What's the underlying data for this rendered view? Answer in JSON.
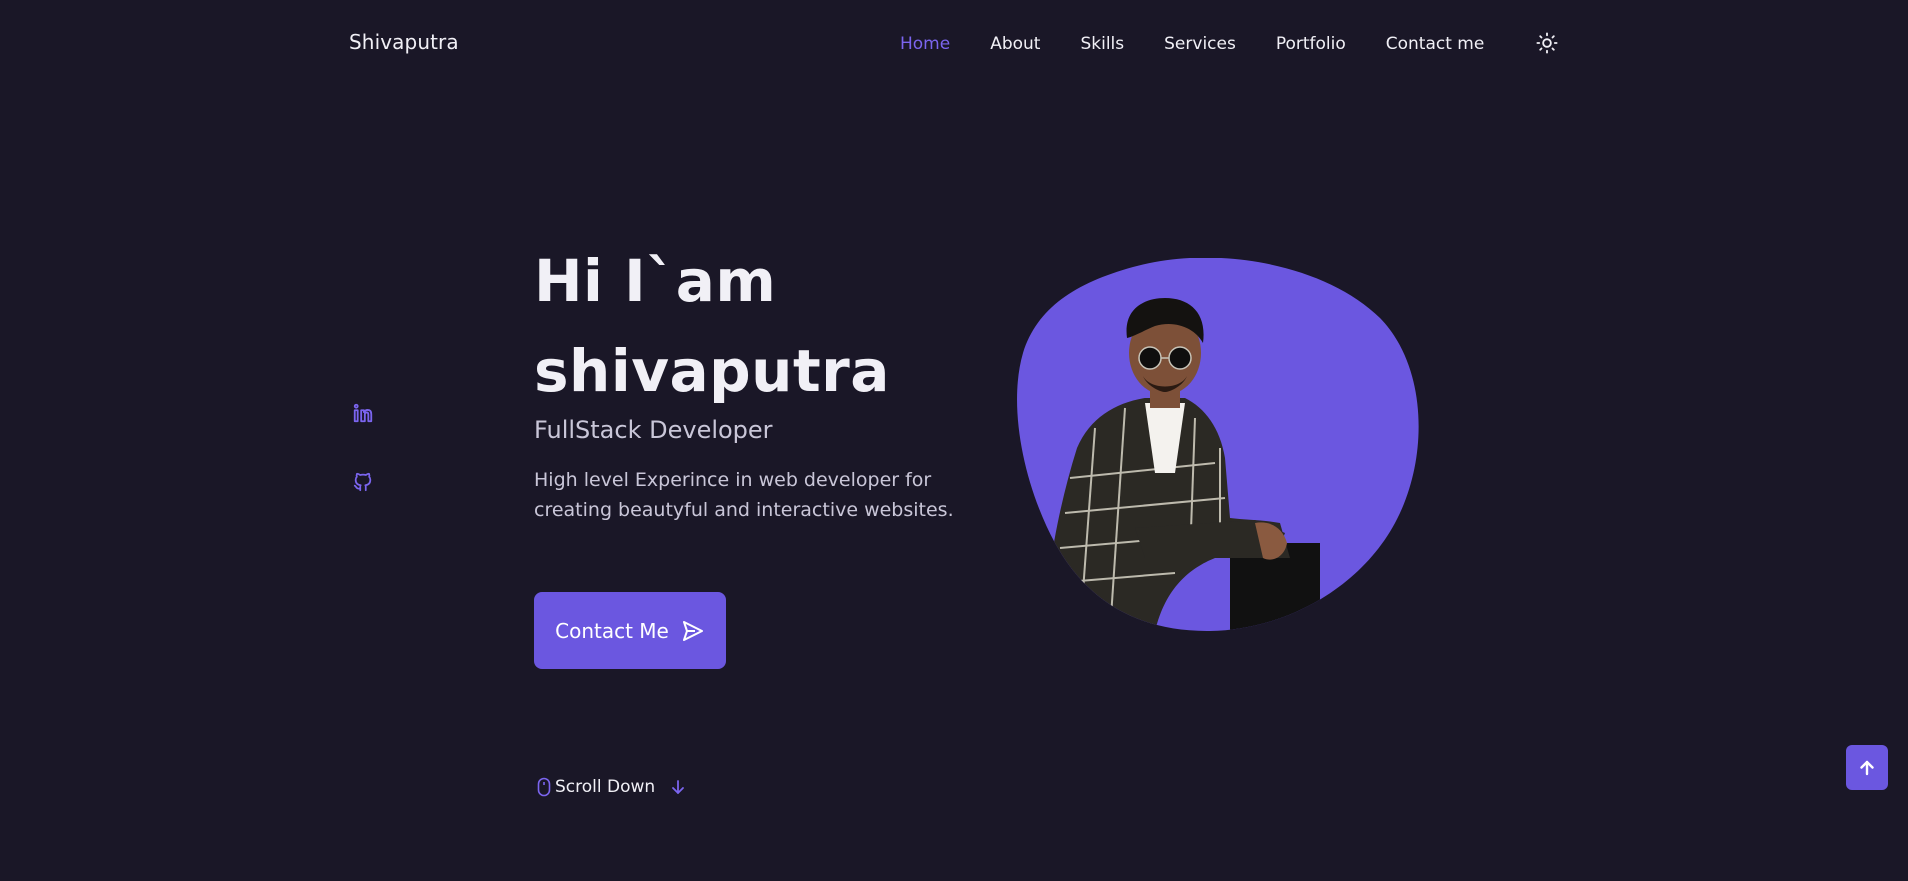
{
  "header": {
    "brand": "Shivaputra",
    "nav": [
      {
        "label": "Home",
        "active": true
      },
      {
        "label": "About",
        "active": false
      },
      {
        "label": "Skills",
        "active": false
      },
      {
        "label": "Services",
        "active": false
      },
      {
        "label": "Portfolio",
        "active": false
      },
      {
        "label": "Contact me",
        "active": false
      }
    ],
    "theme_icon": "sun-icon"
  },
  "social": [
    {
      "icon": "linkedin-icon"
    },
    {
      "icon": "github-icon"
    }
  ],
  "hero": {
    "title_line1": "Hi I`am",
    "title_line2": "shivaputra",
    "subtitle": "FullStack Developer",
    "description": "High level Experince in web developer for creating beautyful and interactive websites.",
    "cta_label": "Contact Me",
    "cta_icon": "send-icon",
    "scroll_label": "Scroll Down",
    "scroll_icon": "mouse-icon",
    "scroll_arrow_icon": "arrow-down-icon"
  },
  "colors": {
    "background": "#1a1727",
    "accent": "#6b57e0",
    "accent_light": "#7b65ef",
    "text": "#f1f0f6",
    "muted": "#c9c6d8"
  },
  "scroll_up_icon": "arrow-up-icon"
}
